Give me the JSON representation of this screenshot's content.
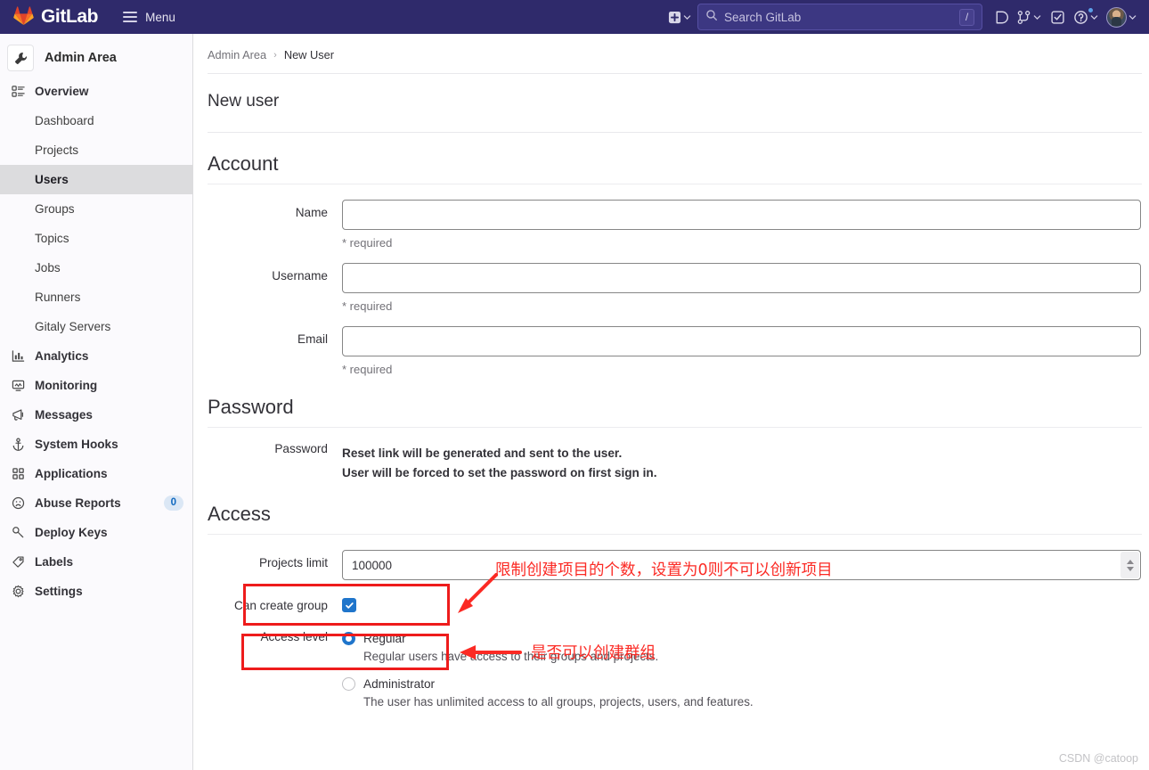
{
  "navbar": {
    "brand": "GitLab",
    "menu_label": "Menu",
    "search_placeholder": "Search GitLab",
    "search_value": "",
    "search_shortcut": "/",
    "icons": {
      "create_new": "plus-square-icon",
      "issues": "issues-icon",
      "merge_requests": "merge-request-icon",
      "todos": "todo-check-icon",
      "help": "help-circle-icon",
      "avatar": "user-avatar"
    },
    "bg_color": "#2f2a6b"
  },
  "sidebar": {
    "context_title": "Admin Area",
    "context_icon": "wrench-icon",
    "items": [
      {
        "label": "Overview",
        "icon": "overview-icon",
        "level": "top",
        "active": false
      },
      {
        "label": "Dashboard",
        "icon": "",
        "level": "sub",
        "active": false
      },
      {
        "label": "Projects",
        "icon": "",
        "level": "sub",
        "active": false
      },
      {
        "label": "Users",
        "icon": "",
        "level": "sub",
        "active": true
      },
      {
        "label": "Groups",
        "icon": "",
        "level": "sub",
        "active": false
      },
      {
        "label": "Topics",
        "icon": "",
        "level": "sub",
        "active": false
      },
      {
        "label": "Jobs",
        "icon": "",
        "level": "sub",
        "active": false
      },
      {
        "label": "Runners",
        "icon": "",
        "level": "sub",
        "active": false
      },
      {
        "label": "Gitaly Servers",
        "icon": "",
        "level": "sub",
        "active": false
      },
      {
        "label": "Analytics",
        "icon": "analytics-chart-icon",
        "level": "top",
        "active": false
      },
      {
        "label": "Monitoring",
        "icon": "monitor-icon",
        "level": "top",
        "active": false
      },
      {
        "label": "Messages",
        "icon": "megaphone-icon",
        "level": "top",
        "active": false
      },
      {
        "label": "System Hooks",
        "icon": "anchor-icon",
        "level": "top",
        "active": false
      },
      {
        "label": "Applications",
        "icon": "grid-apps-icon",
        "level": "top",
        "active": false
      },
      {
        "label": "Abuse Reports",
        "icon": "sad-face-icon",
        "level": "top",
        "active": false,
        "badge": "0"
      },
      {
        "label": "Deploy Keys",
        "icon": "key-icon",
        "level": "top",
        "active": false
      },
      {
        "label": "Labels",
        "icon": "label-tag-icon",
        "level": "top",
        "active": false
      },
      {
        "label": "Settings",
        "icon": "gear-icon",
        "level": "top",
        "active": false
      }
    ]
  },
  "breadcrumb": {
    "parent": "Admin Area",
    "separator": "›",
    "current": "New User"
  },
  "page": {
    "title": "New user"
  },
  "account": {
    "heading": "Account",
    "name_label": "Name",
    "name_value": "",
    "name_help": "* required",
    "username_label": "Username",
    "username_value": "",
    "username_help": "* required",
    "email_label": "Email",
    "email_value": "",
    "email_help": "* required"
  },
  "password": {
    "heading": "Password",
    "label": "Password",
    "line1": "Reset link will be generated and sent to the user.",
    "line2": "User will be forced to set the password on first sign in."
  },
  "access": {
    "heading": "Access",
    "projects_limit_label": "Projects limit",
    "projects_limit_value": "100000",
    "can_create_group_label": "Can create group",
    "can_create_group_checked": true,
    "access_level_label": "Access level",
    "options": [
      {
        "label": "Regular",
        "desc": "Regular users have access to their groups and projects.",
        "selected": true
      },
      {
        "label": "Administrator",
        "desc": "The user has unlimited access to all groups, projects, users, and features.",
        "selected": false
      }
    ]
  },
  "annotations": {
    "color": "#fb2a24",
    "box_color": "#ee1c1c",
    "note_projects_limit": "限制创建项目的个数，设置为0则不可以创新项目",
    "note_can_create_group": "是否可以创建群组"
  },
  "watermark": "CSDN @catoop"
}
